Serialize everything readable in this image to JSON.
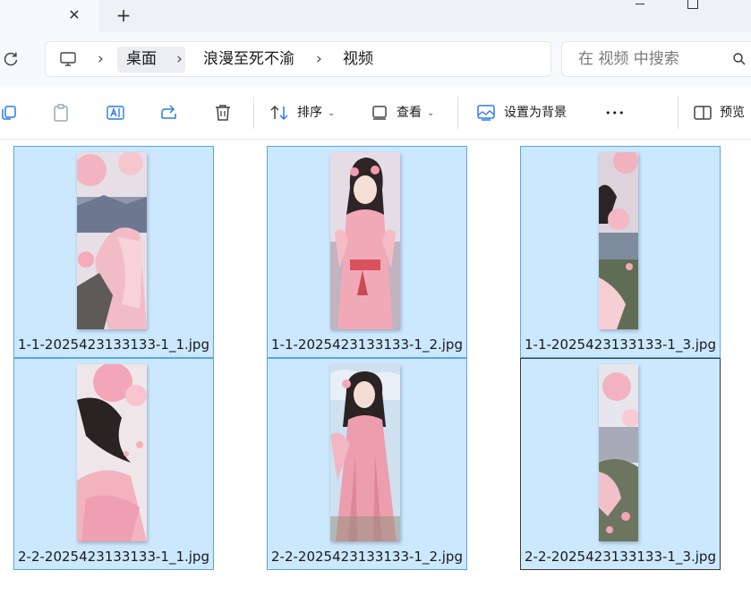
{
  "titlebar": {
    "close_tab_glyph": "✕",
    "new_tab_glyph": "+"
  },
  "address_bar": {
    "breadcrumbs": [
      "桌面",
      "浪漫至死不渝",
      "视频"
    ],
    "separator": "›"
  },
  "search": {
    "placeholder": "在 视频 中搜索"
  },
  "toolbar": {
    "sort_label": "排序",
    "view_label": "查看",
    "set_background_label": "设置为背景",
    "more_label": "•••",
    "preview_label": "预览"
  },
  "files": [
    {
      "name": "1-1-2025423133133-1_1.jpg"
    },
    {
      "name": "1-1-2025423133133-1_2.jpg"
    },
    {
      "name": "1-1-2025423133133-1_3.jpg"
    },
    {
      "name": "2-2-2025423133133-1_1.jpg"
    },
    {
      "name": "2-2-2025423133133-1_2.jpg"
    },
    {
      "name": "2-2-2025423133133-1_3.jpg"
    }
  ],
  "colors": {
    "selection_fill": "#cce8ff",
    "selection_border": "#5aa5e6",
    "accent": "#0067c0"
  }
}
